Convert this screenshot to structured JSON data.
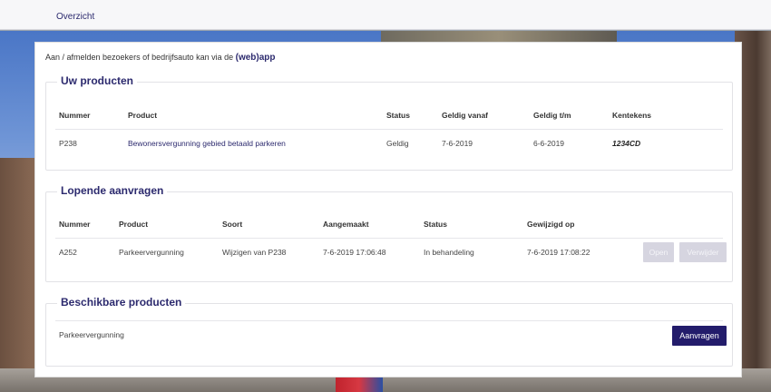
{
  "nav": {
    "overview": "Overzicht"
  },
  "intro": {
    "text": "Aan / afmelden bezoekers of bedrijfsauto kan via de ",
    "app_label": "(web)app"
  },
  "products": {
    "title": "Uw producten",
    "headers": {
      "number": "Nummer",
      "product": "Product",
      "status": "Status",
      "valid_from": "Geldig vanaf",
      "valid_to": "Geldig t/m",
      "plates": "Kentekens"
    },
    "rows": [
      {
        "number": "P238",
        "product": "Bewonersvergunning gebied betaald parkeren",
        "status": "Geldig",
        "valid_from": "7-6-2019",
        "valid_to": "6-6-2019",
        "plates": "1234CD"
      }
    ]
  },
  "requests": {
    "title": "Lopende aanvragen",
    "headers": {
      "number": "Nummer",
      "product": "Product",
      "kind": "Soort",
      "created": "Aangemaakt",
      "status": "Status",
      "modified": "Gewijzigd op"
    },
    "rows": [
      {
        "number": "A252",
        "product": "Parkeervergunning",
        "kind": "Wijzigen van P238",
        "created": "7-6-2019 17:06:48",
        "status": "In behandeling",
        "modified": "7-6-2019 17:08:22",
        "open_label": "Open",
        "delete_label": "Verwijder"
      }
    ]
  },
  "available": {
    "title": "Beschikbare producten",
    "rows": [
      {
        "product": "Parkeervergunning",
        "request_label": "Aanvragen"
      }
    ]
  },
  "colors": {
    "brand": "#231c6b",
    "link": "#2c2a6e",
    "disabled_button": "#d6d5e0"
  }
}
